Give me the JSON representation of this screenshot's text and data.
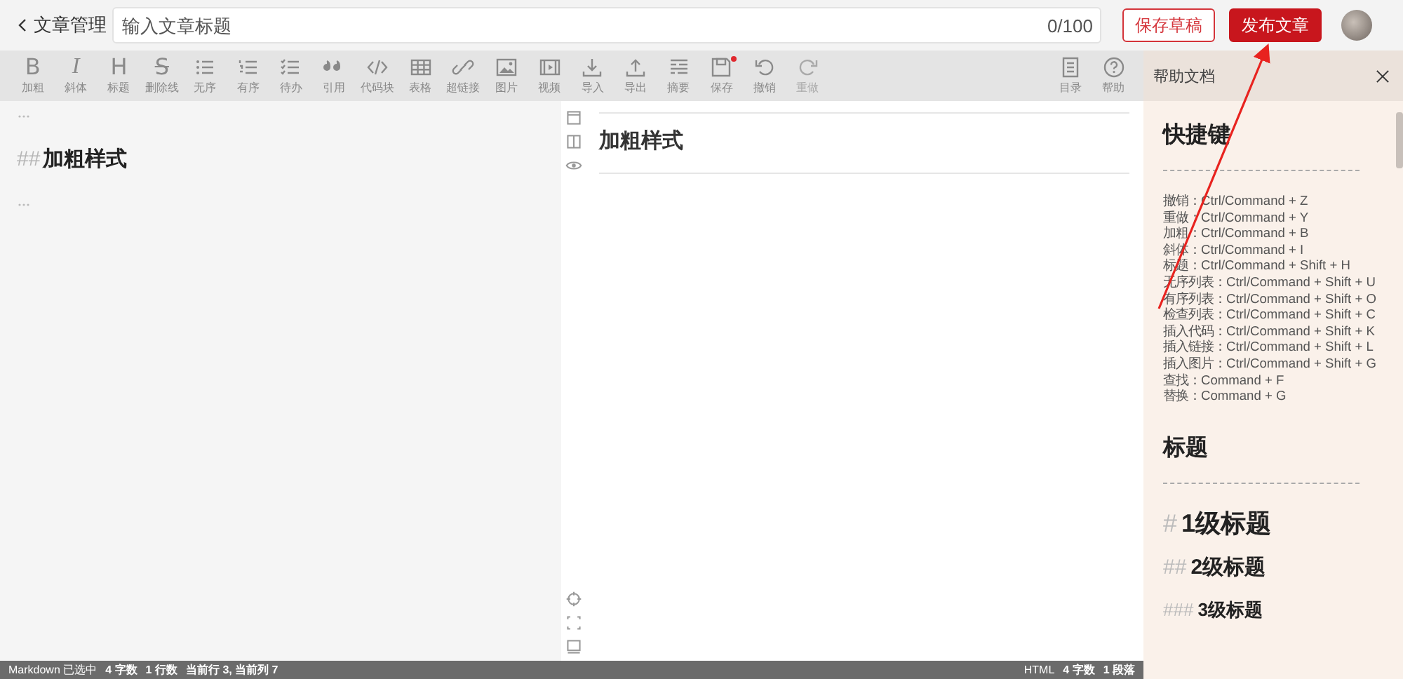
{
  "header": {
    "back_label": "文章管理",
    "title_placeholder": "输入文章标题",
    "counter": "0/100",
    "buttons": [
      {
        "label": "保存草稿",
        "kind": "outline"
      },
      {
        "label": "发布文章",
        "kind": "primary"
      }
    ]
  },
  "toolbar": {
    "items": [
      {
        "label": "加粗",
        "glyph": "B",
        "disabled": false,
        "dot": false
      },
      {
        "label": "斜体",
        "glyph": "I",
        "disabled": false,
        "dot": false
      },
      {
        "label": "标题",
        "glyph": "H",
        "disabled": false,
        "dot": false
      },
      {
        "label": "删除线",
        "glyph": "S",
        "disabled": false,
        "dot": false
      },
      {
        "label": "无序",
        "disabled": false,
        "dot": false
      },
      {
        "label": "有序",
        "disabled": false,
        "dot": false
      },
      {
        "label": "待办",
        "disabled": false,
        "dot": false
      },
      {
        "label": "引用",
        "disabled": false,
        "dot": false
      },
      {
        "label": "代码块",
        "disabled": false,
        "dot": false
      },
      {
        "label": "表格",
        "disabled": false,
        "dot": false
      },
      {
        "label": "超链接",
        "disabled": false,
        "dot": false
      },
      {
        "label": "图片",
        "disabled": false,
        "dot": false
      },
      {
        "label": "视频",
        "disabled": false,
        "dot": false
      },
      {
        "label": "导入",
        "disabled": false,
        "dot": false
      },
      {
        "label": "导出",
        "disabled": false,
        "dot": false
      },
      {
        "label": "摘要",
        "disabled": false,
        "dot": false
      },
      {
        "label": "保存",
        "disabled": false,
        "dot": true
      },
      {
        "label": "撤销",
        "disabled": false,
        "dot": false
      },
      {
        "label": "重做",
        "disabled": true,
        "dot": false
      }
    ],
    "right_items": [
      {
        "label": "目录",
        "disabled": false,
        "dot": false
      },
      {
        "label": "帮助",
        "disabled": false,
        "dot": false
      }
    ]
  },
  "editor": {
    "lines": [
      {
        "kind": "dots"
      },
      {
        "kind": "heading",
        "marker": "##",
        "text": "加粗样式"
      },
      {
        "kind": "dots"
      }
    ]
  },
  "preview": {
    "heading": "加粗样式"
  },
  "status_bar": {
    "left": [
      "Markdown 已选中",
      "4 字数",
      "1 行数",
      "当前行 3, 当前列 7"
    ],
    "right": [
      "HTML",
      "4 字数",
      "1 段落"
    ]
  },
  "help": {
    "title": "帮助文档",
    "sections": [
      {
        "title": "快捷键",
        "lines": [
          "撤销：Ctrl/Command + Z",
          "重做：Ctrl/Command + Y",
          "加粗：Ctrl/Command + B",
          "斜体：Ctrl/Command + I",
          "标题：Ctrl/Command + Shift + H",
          "无序列表：Ctrl/Command + Shift + U",
          "有序列表：Ctrl/Command + Shift + O",
          "检查列表：Ctrl/Command + Shift + C",
          "插入代码：Ctrl/Command + Shift + K",
          "插入链接：Ctrl/Command + Shift + L",
          "插入图片：Ctrl/Command + Shift + G",
          "查找：Command + F",
          "替换：Command + G"
        ]
      },
      {
        "title": "标题",
        "headings": [
          {
            "kind": "h1",
            "marker": "#",
            "text": "1级标题"
          },
          {
            "kind": "h2",
            "marker": "##",
            "text": "2级标题"
          },
          {
            "kind": "h3",
            "marker": "###",
            "text": "3级标题"
          }
        ]
      }
    ]
  }
}
